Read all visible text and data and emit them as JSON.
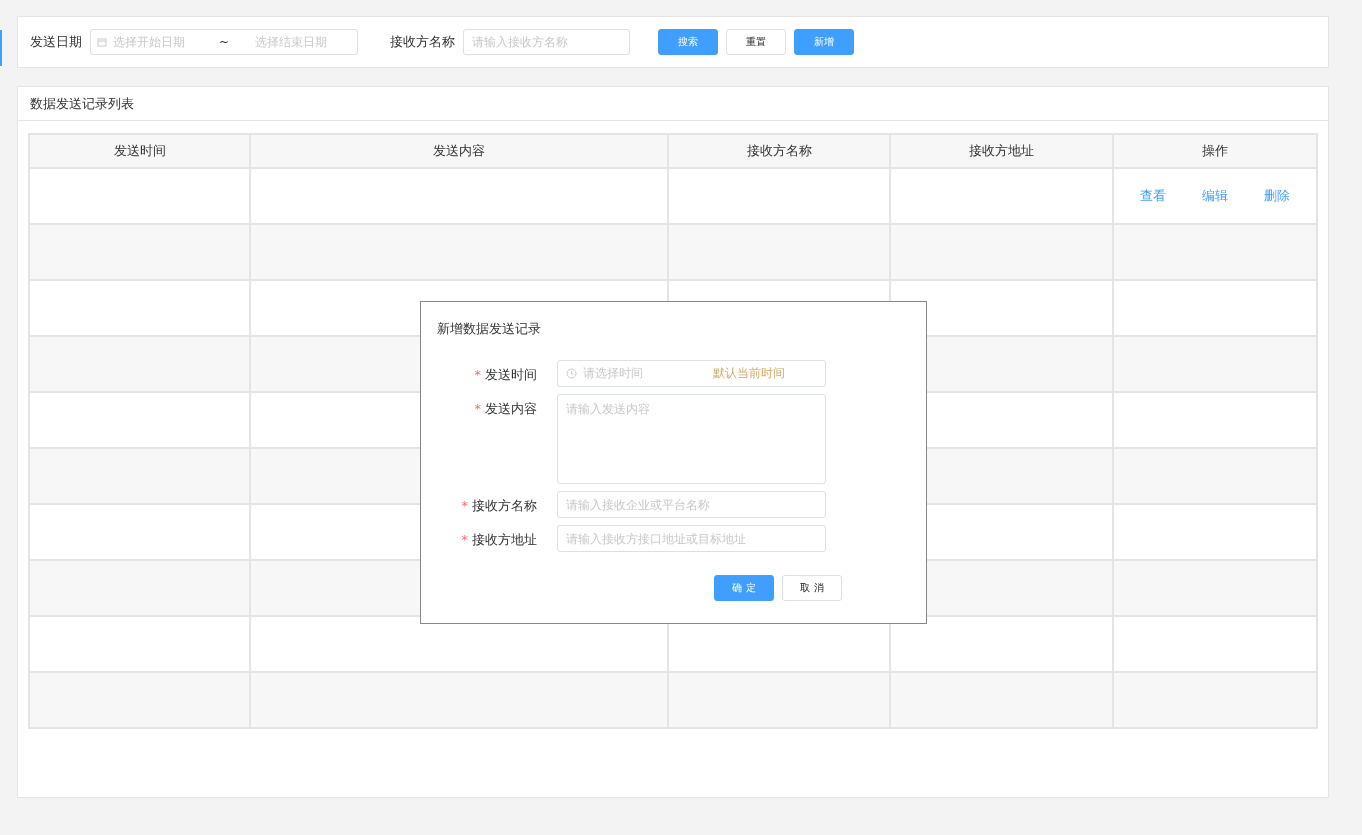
{
  "filter": {
    "date_label": "发送日期",
    "start_placeholder": "选择开始日期",
    "separator": "~",
    "end_placeholder": "选择结束日期",
    "receiver_label": "接收方名称",
    "receiver_placeholder": "请输入接收方名称",
    "buttons": [
      {
        "label": "搜索",
        "kind": "primary"
      },
      {
        "label": "重置",
        "kind": "default"
      },
      {
        "label": "新增",
        "kind": "primary"
      }
    ]
  },
  "list": {
    "title": "数据发送记录列表",
    "columns": [
      "发送时间",
      "发送内容",
      "接收方名称",
      "接收方地址",
      "操作"
    ],
    "rows": [
      {
        "kind": "record",
        "actions": [
          "查看",
          "编辑",
          "删除"
        ]
      },
      {
        "kind": "empty"
      },
      {
        "kind": "empty"
      },
      {
        "kind": "empty"
      },
      {
        "kind": "empty"
      },
      {
        "kind": "empty"
      },
      {
        "kind": "empty"
      },
      {
        "kind": "empty"
      },
      {
        "kind": "empty"
      },
      {
        "kind": "empty"
      }
    ]
  },
  "dialog": {
    "title": "新增数据发送记录",
    "fields": [
      {
        "label": "发送时间",
        "required_mark": "*",
        "kind": "time",
        "placeholder": "请选择时间",
        "hint": "默认当前时间"
      },
      {
        "label": "发送内容",
        "required_mark": "*",
        "kind": "textarea",
        "placeholder": "请输入发送内容"
      },
      {
        "label": "接收方名称",
        "required_mark": "*",
        "kind": "input",
        "placeholder": "请输入接收企业或平台名称"
      },
      {
        "label": "接收方地址",
        "required_mark": "*",
        "kind": "input",
        "placeholder": "请输入接收方接口地址或目标地址"
      }
    ],
    "buttons": [
      {
        "label": "确 定",
        "kind": "primary"
      },
      {
        "label": "取 消",
        "kind": "default"
      }
    ]
  }
}
